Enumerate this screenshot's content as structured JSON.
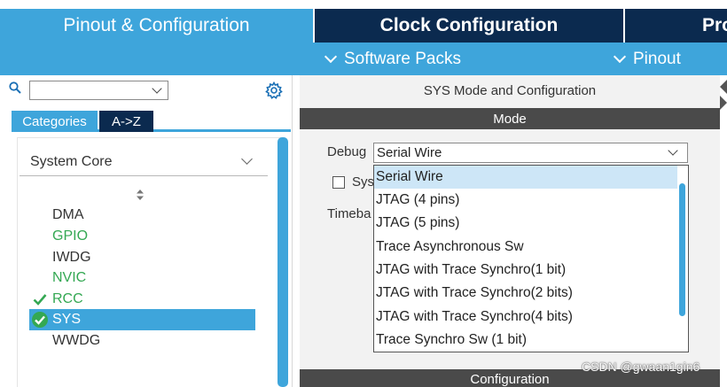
{
  "tabs": {
    "pinout": "Pinout & Configuration",
    "clock": "Clock Configuration",
    "project": "Pro"
  },
  "subbar": {
    "software_packs": "Software Packs",
    "pinout": "Pinout"
  },
  "left": {
    "search_value": "",
    "category_tabs": [
      "Categories",
      "A->Z"
    ],
    "group": "System Core",
    "items": [
      "DMA",
      "GPIO",
      "IWDG",
      "NVIC",
      "RCC",
      "SYS",
      "WWDG"
    ]
  },
  "right": {
    "panel_title": "SYS Mode and Configuration",
    "mode_header": "Mode",
    "debug_label": "Debug",
    "debug_value": "Serial Wire",
    "sys_label": "Sys",
    "timebase_label": "Timeba",
    "config_header": "Configuration"
  },
  "dropdown": {
    "options": [
      "Serial Wire",
      "JTAG (4 pins)",
      "JTAG (5 pins)",
      "Trace Asynchronous Sw",
      "JTAG with Trace Synchro(1 bit)",
      "JTAG with Trace Synchro(2 bits)",
      "JTAG with Trace Synchro(4 bits)",
      "Trace Synchro Sw (1 bit)"
    ],
    "selected": "Serial Wire"
  },
  "watermark": "CSDN @gwaan1gin6",
  "colors": {
    "accent": "#3ea5db",
    "navy": "#0b2a4f",
    "header_dark": "#4a4a4a",
    "configured_green": "#34a853"
  }
}
